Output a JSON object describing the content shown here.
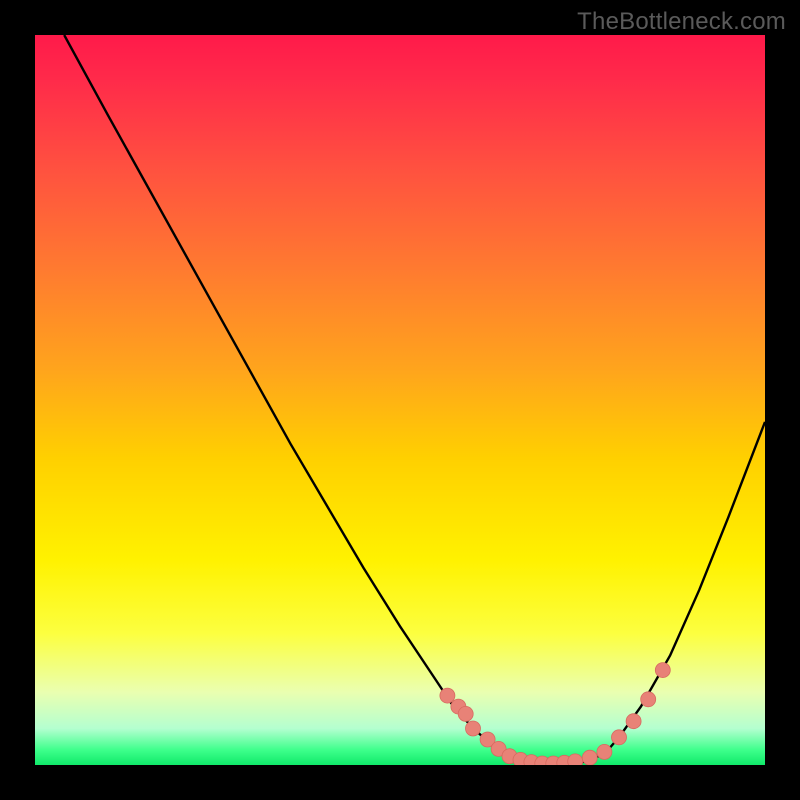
{
  "watermark": "TheBottleneck.com",
  "colors": {
    "gradient_top": "#ff1a4a",
    "gradient_bottom": "#10e96a",
    "curve": "#000000",
    "marker": "#e88277",
    "marker_stroke": "#d76a60"
  },
  "chart_data": {
    "type": "line",
    "title": "",
    "xlabel": "",
    "ylabel": "",
    "xlim": [
      0,
      100
    ],
    "ylim": [
      0,
      100
    ],
    "x": [
      4,
      10,
      15,
      20,
      25,
      30,
      35,
      40,
      45,
      50,
      55,
      57,
      60,
      63,
      66,
      69,
      72,
      75,
      78,
      80,
      83,
      87,
      91,
      95,
      100
    ],
    "values": [
      100,
      89,
      80,
      71,
      62,
      53,
      44,
      35.5,
      27,
      19,
      11.5,
      8.5,
      5.0,
      2.5,
      1.2,
      0.5,
      0.2,
      0.4,
      1.5,
      3.8,
      8.0,
      15,
      24,
      34,
      47
    ],
    "markers_x": [
      56.5,
      58,
      59,
      60,
      62,
      63.5,
      65,
      66.5,
      68,
      69.5,
      71,
      72.5,
      74,
      76,
      78,
      80,
      82,
      84,
      86
    ],
    "markers_y": [
      9.5,
      8.0,
      7.0,
      5.0,
      3.5,
      2.2,
      1.2,
      0.7,
      0.4,
      0.2,
      0.2,
      0.3,
      0.5,
      1.0,
      1.8,
      3.8,
      6.0,
      9.0,
      13.0
    ]
  }
}
